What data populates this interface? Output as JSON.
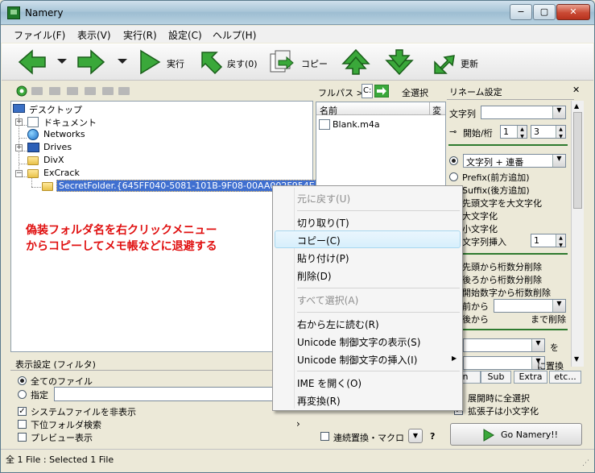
{
  "window": {
    "title": "Namery",
    "btn_min": "−",
    "btn_max": "▢",
    "btn_close": "✕"
  },
  "menu": [
    "ファイル(F)",
    "表示(V)",
    "実行(R)",
    "設定(C)",
    "ヘルプ(H)"
  ],
  "toolbar": {
    "run": "実行",
    "undo": "戻す(0)",
    "copy": "コピー",
    "update": "更新"
  },
  "tree": {
    "items": [
      "デスクトップ",
      "ドキュメント",
      "Networks",
      "Drives",
      "DivX",
      "ExCrack"
    ],
    "selected": "SecretFolder.{645FF040-5081-101B-9F08-00AA002F954E}"
  },
  "annotation": {
    "line1": "偽装フォルダ名を右クリックメニュー",
    "line2": "からコピーしてメモ帳などに退避する"
  },
  "filelist": {
    "path_label": "フルパス >",
    "path_value": "C:",
    "select_all": "全選択",
    "col_name": "名前",
    "col_more": "変",
    "file": "Blank.m4a"
  },
  "rename": {
    "title": "リネーム設定",
    "close": "✕",
    "string_label": "文字列",
    "start_label": "開始/桁",
    "start_value": "1",
    "digits_value": "3",
    "mode_selected": "文字列 + 連番",
    "options": [
      "Prefix(前方追加)",
      "Suffix(後方追加)",
      "先頭文字を大文字化",
      "大文字化",
      "小文字化"
    ],
    "insert_label": "文字列挿入",
    "insert_value": "1",
    "delete_opts": [
      "先頭から桁数分削除",
      "後ろから桁数分削除",
      "開始数字から桁数削除"
    ],
    "from_front": "前から",
    "from_back": "後から",
    "delete_until": "まで削除",
    "wo": "を",
    "replace": "に置換",
    "tabs": [
      "n",
      "Sub",
      "Extra",
      "etc..."
    ],
    "check_expand": "展開時に全選択",
    "check_ext": "拡張子は小文字化",
    "go": "Go Namery!!"
  },
  "filter": {
    "title": "表示設定 (フィルタ)",
    "all_files": "全てのファイル",
    "specify": "指定",
    "hide_sys": "システムファイルを非表示",
    "subfolder": "下位フォルダ検索",
    "preview": "プレビュー表示"
  },
  "bottom": {
    "continuous": "連続置換・マクロ",
    "question": "?"
  },
  "context_menu": {
    "undo": "元に戻す(U)",
    "cut": "切り取り(T)",
    "copy": "コピー(C)",
    "paste": "貼り付け(P)",
    "delete": "削除(D)",
    "select_all": "すべて選択(A)",
    "rtl": "右から左に読む(R)",
    "show_unicode": "Unicode 制御文字の表示(S)",
    "insert_unicode": "Unicode 制御文字の挿入(I)",
    "ime_open": "IME を開く(O)",
    "reconvert": "再変換(R)"
  },
  "status": "全 1 File : Selected 1 File",
  "colors": {
    "accent": "#2e7a2e",
    "highlight": "#3f6fd0",
    "annotation": "#e01010"
  }
}
